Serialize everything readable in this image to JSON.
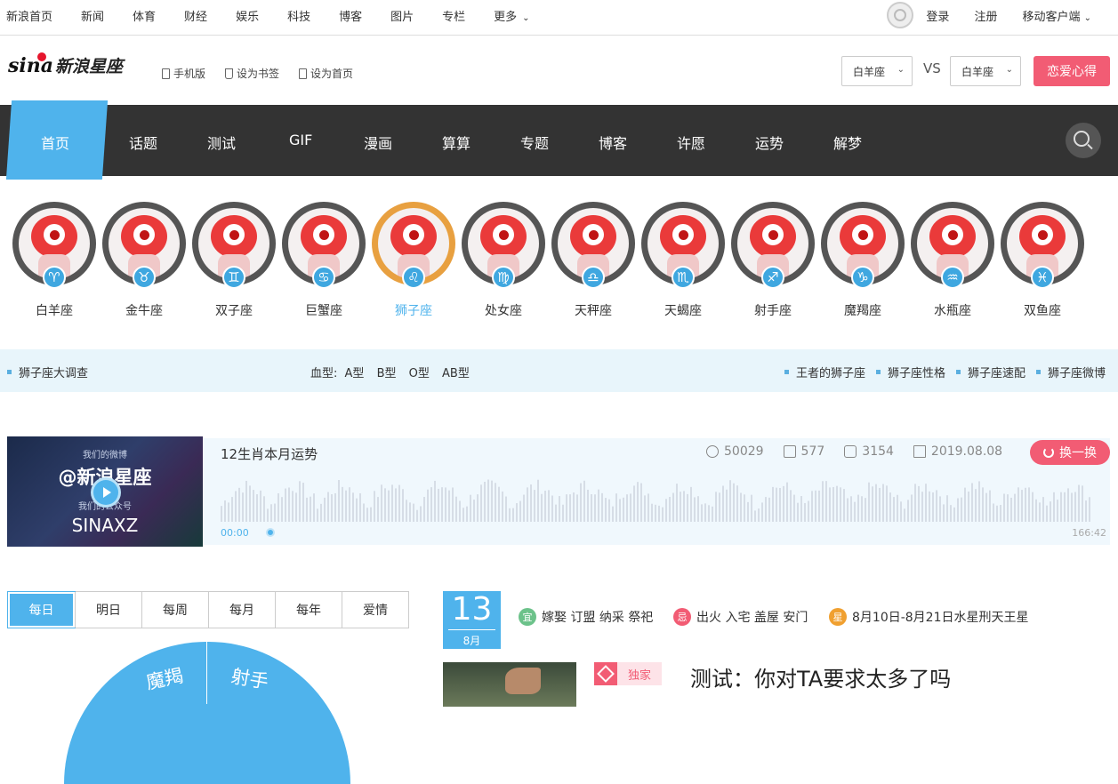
{
  "topbar": {
    "nav": [
      "新浪首页",
      "新闻",
      "体育",
      "财经",
      "娱乐",
      "科技",
      "博客",
      "图片",
      "专栏",
      "更多"
    ],
    "login": "登录",
    "register": "注册",
    "mobile_client": "移动客户端"
  },
  "header": {
    "logo_sina": "sina",
    "logo_text": "新浪星座",
    "links": [
      "手机版",
      "设为书签",
      "设为首页"
    ],
    "select_left": "白羊座",
    "vs": "VS",
    "select_right": "白羊座",
    "love_button": "恋爱心得"
  },
  "mainnav": {
    "items": [
      "首页",
      "话题",
      "测试",
      "GIF",
      "漫画",
      "算算",
      "专题",
      "博客",
      "许愿",
      "运势",
      "解梦"
    ],
    "active": "首页"
  },
  "zodiac": {
    "signs": [
      {
        "name": "白羊座",
        "symbol": "♈"
      },
      {
        "name": "金牛座",
        "symbol": "♉"
      },
      {
        "name": "双子座",
        "symbol": "♊"
      },
      {
        "name": "巨蟹座",
        "symbol": "♋"
      },
      {
        "name": "狮子座",
        "symbol": "♌"
      },
      {
        "name": "处女座",
        "symbol": "♍"
      },
      {
        "name": "天秤座",
        "symbol": "♎"
      },
      {
        "name": "天蝎座",
        "symbol": "♏"
      },
      {
        "name": "射手座",
        "symbol": "♐"
      },
      {
        "name": "魔羯座",
        "symbol": "♑"
      },
      {
        "name": "水瓶座",
        "symbol": "♒"
      },
      {
        "name": "双鱼座",
        "symbol": "♓"
      }
    ],
    "active": "狮子座"
  },
  "strip": {
    "survey": "狮子座大调查",
    "blood_label": "血型:",
    "blood_types": [
      "A型",
      "B型",
      "O型",
      "AB型"
    ],
    "right_links": [
      "王者的狮子座",
      "狮子座性格",
      "狮子座速配",
      "狮子座微博"
    ]
  },
  "audio": {
    "thumb_line1": "我们的微博",
    "thumb_line2": "@新浪星座",
    "thumb_line3": "我们的公众号",
    "thumb_line4": "SINAXZ",
    "title": "12生肖本月运势",
    "plays": "50029",
    "comments": "577",
    "likes": "3154",
    "date": "2019.08.08",
    "swap_button": "换一换",
    "time_start": "00:00",
    "time_end": "166:42",
    "progress": 0.0
  },
  "fortune_tabs": [
    "每日",
    "明日",
    "每周",
    "每月",
    "每年",
    "爱情"
  ],
  "wheel": [
    "魔羯",
    "射手"
  ],
  "almanac": {
    "day": "13",
    "month": "8月",
    "yi_icon": "宜",
    "yi_text": "嫁娶 订盟 纳采 祭祀",
    "ji_icon": "忌",
    "ji_text": "出火 入宅 盖屋 安门",
    "xing_icon": "星",
    "xing_text": "8月10日-8月21日水星刑天王星"
  },
  "news": {
    "badge": "独家",
    "title": "测试：你对TA要求太多了吗"
  },
  "colors": {
    "accent_blue": "#4fb3ec",
    "accent_pink": "#f25c74",
    "nav_dark": "#333333",
    "strip_bg": "#e8f5fb"
  }
}
